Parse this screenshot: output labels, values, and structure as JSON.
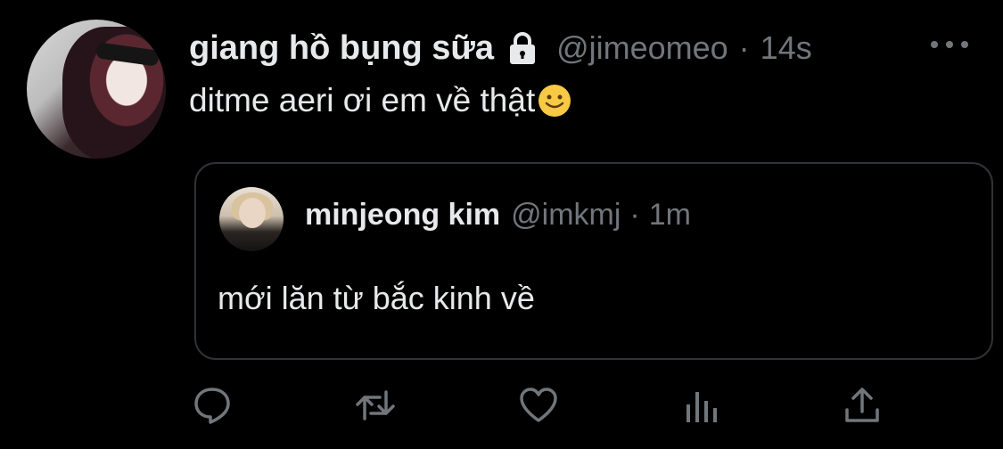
{
  "tweet": {
    "display_name": "giang hồ bụng sữa",
    "handle": "@jimeomeo",
    "separator": "·",
    "time": "14s",
    "text": "ditme aeri ơi em về thật",
    "lock_icon": "lock-icon",
    "emoji_icon": "slightly-smiling-face-emoji",
    "more_icon": "more-dots-icon"
  },
  "quoted": {
    "display_name": "minjeong kim",
    "handle": "@imkmj",
    "separator": "·",
    "time": "1m",
    "text": "mới lăn từ bắc kinh về"
  },
  "actions": [
    {
      "name": "reply",
      "icon": "reply-bubble-icon"
    },
    {
      "name": "retweet",
      "icon": "retweet-arrows-icon"
    },
    {
      "name": "like",
      "icon": "heart-icon"
    },
    {
      "name": "analytics",
      "icon": "bar-chart-icon"
    },
    {
      "name": "share",
      "icon": "share-upload-icon"
    }
  ],
  "colors": {
    "background": "#000000",
    "primary_text": "#e7e9ea",
    "secondary_text": "#71767b",
    "border": "#2f3336",
    "emoji_yellow": "#f7c945"
  }
}
